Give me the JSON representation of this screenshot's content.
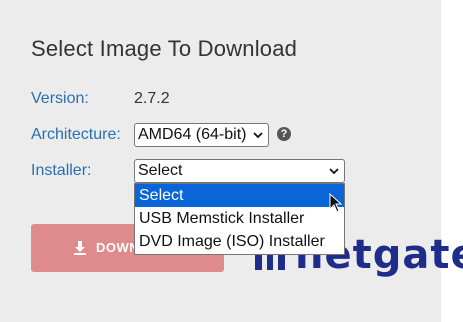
{
  "page": {
    "title": "Select Image To Download"
  },
  "fields": {
    "version_label": "Version:",
    "version_value": "2.7.2",
    "architecture_label": "Architecture:",
    "architecture_value": "AMD64 (64-bit)",
    "installer_label": "Installer:",
    "installer_value": "Select"
  },
  "installer_options": [
    {
      "label": "Select",
      "selected": true
    },
    {
      "label": "USB Memstick Installer",
      "selected": false
    },
    {
      "label": "DVD Image (ISO) Installer",
      "selected": false
    }
  ],
  "download_button": {
    "label": "DOWN"
  },
  "logo": {
    "text": "netgate"
  },
  "colors": {
    "label": "#2a6eb4",
    "button": "#e08b8b",
    "highlight": "#0a66d8",
    "logo": "#1e2d8a"
  },
  "icons": {
    "help": "question-circle-icon",
    "download": "download-arrow-icon",
    "chevron": "chevron-down-icon",
    "cursor": "mouse-pointer-icon"
  }
}
